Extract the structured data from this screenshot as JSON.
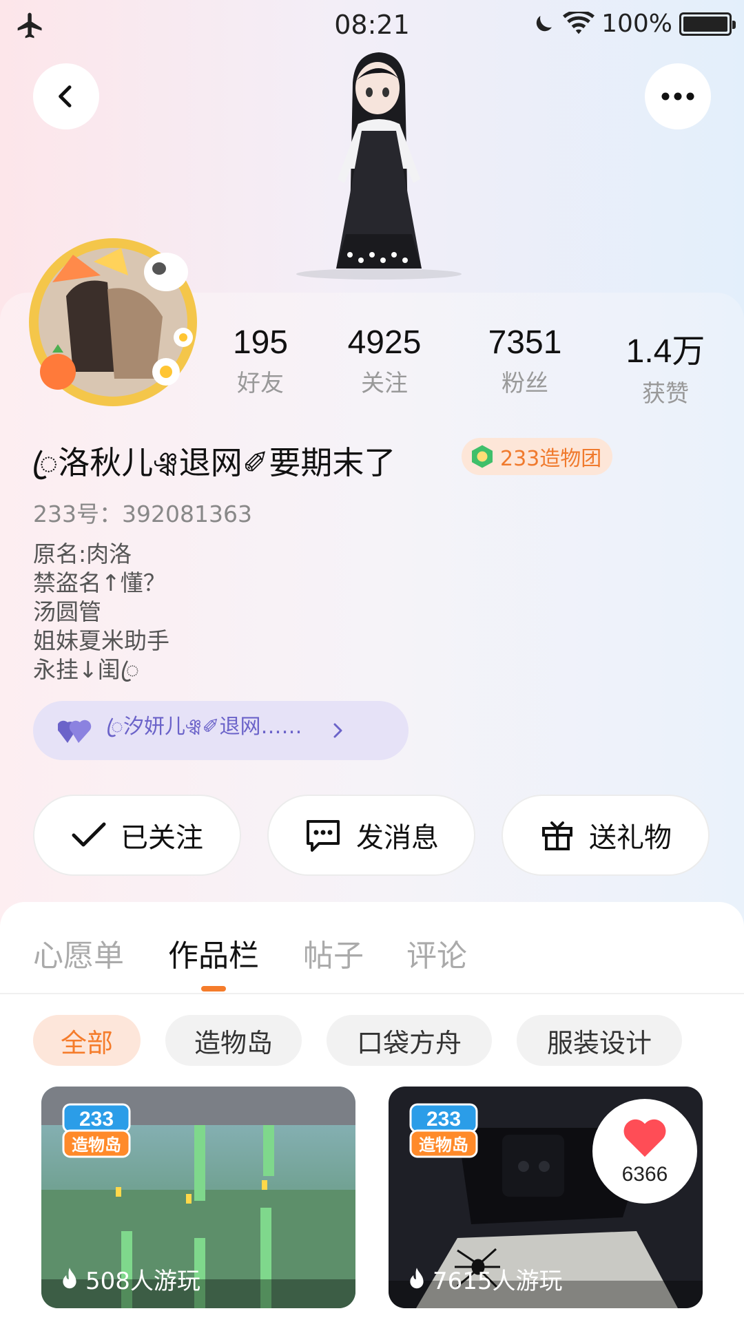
{
  "status_bar": {
    "time": "08:21",
    "battery_pct": "100%",
    "icons": [
      "airplane-icon",
      "moon-icon",
      "wifi-icon",
      "battery-icon"
    ]
  },
  "header": {
    "back_icon": "chevron-left-icon",
    "more_icon": "more-icon"
  },
  "stats": [
    {
      "value": "195",
      "label": "好友"
    },
    {
      "value": "4925",
      "label": "关注"
    },
    {
      "value": "7351",
      "label": "粉丝"
    },
    {
      "value": "1.4万",
      "label": "获赞"
    }
  ],
  "profile": {
    "nickname": "ꦿ洛秋儿ঞ্ঝ退网✐要期末了",
    "badge": "233造物团",
    "uid": "233号：392081363",
    "bio": [
      "原名:肉洛",
      "禁盗名↑懂？",
      "汤圆管",
      "姐妹夏米助手",
      "永挂↓闺ꦿ"
    ]
  },
  "relation_pill": {
    "text": "ꦿ汐妍儿ঞ্ঝ✐退网……",
    "icon": "heart-icon",
    "arrow_icon": "chevron-right-icon"
  },
  "actions": [
    {
      "label": "已关注",
      "icon": "check-icon"
    },
    {
      "label": "发消息",
      "icon": "chat-icon"
    },
    {
      "label": "送礼物",
      "icon": "gift-icon"
    }
  ],
  "tabs": [
    "心愿单",
    "作品栏",
    "帖子",
    "评论"
  ],
  "active_tab": "作品栏",
  "chips": [
    "全部",
    "造物岛",
    "口袋方舟",
    "服装设计"
  ],
  "works": [
    {
      "plays": "508人游玩",
      "logo": "233造物岛"
    },
    {
      "plays": "7615人游玩",
      "logo": "233造物岛",
      "likes": "6366"
    }
  ],
  "colors": {
    "accent": "#f57c2b",
    "pill": "#e6e2f7",
    "pill_text": "#6b63c9"
  }
}
